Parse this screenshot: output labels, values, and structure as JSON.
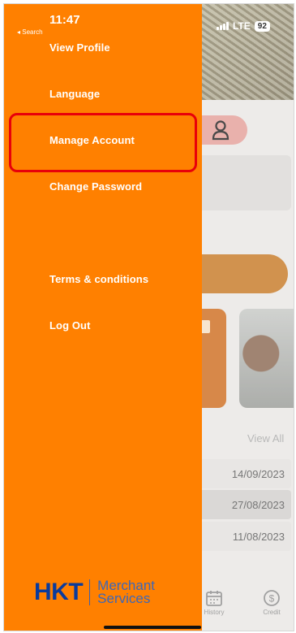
{
  "status_bar": {
    "time": "11:47",
    "back_label": "◂ Search",
    "network": "LTE",
    "battery": "92"
  },
  "drawer": {
    "menu": [
      {
        "label": "View Profile"
      },
      {
        "label": "Language"
      },
      {
        "label": "Manage Account"
      },
      {
        "label": "Change Password"
      },
      {
        "label": "Terms & conditions"
      },
      {
        "label": "Log Out"
      }
    ],
    "highlighted_item": "Manage Account",
    "logo": {
      "brand": "HKT",
      "line1": "Merchant",
      "line2": "Services"
    }
  },
  "background": {
    "view_all_label": "View All",
    "dates": [
      "14/09/2023",
      "27/08/2023",
      "11/08/2023"
    ],
    "tabs": [
      {
        "label": "History",
        "icon": "calendar-icon"
      },
      {
        "label": "Credit",
        "icon": "dollar-icon"
      }
    ]
  },
  "colors": {
    "drawer": "#ff8000",
    "highlight_border": "#e8000a",
    "logo_blue": "#0a3b9c"
  }
}
